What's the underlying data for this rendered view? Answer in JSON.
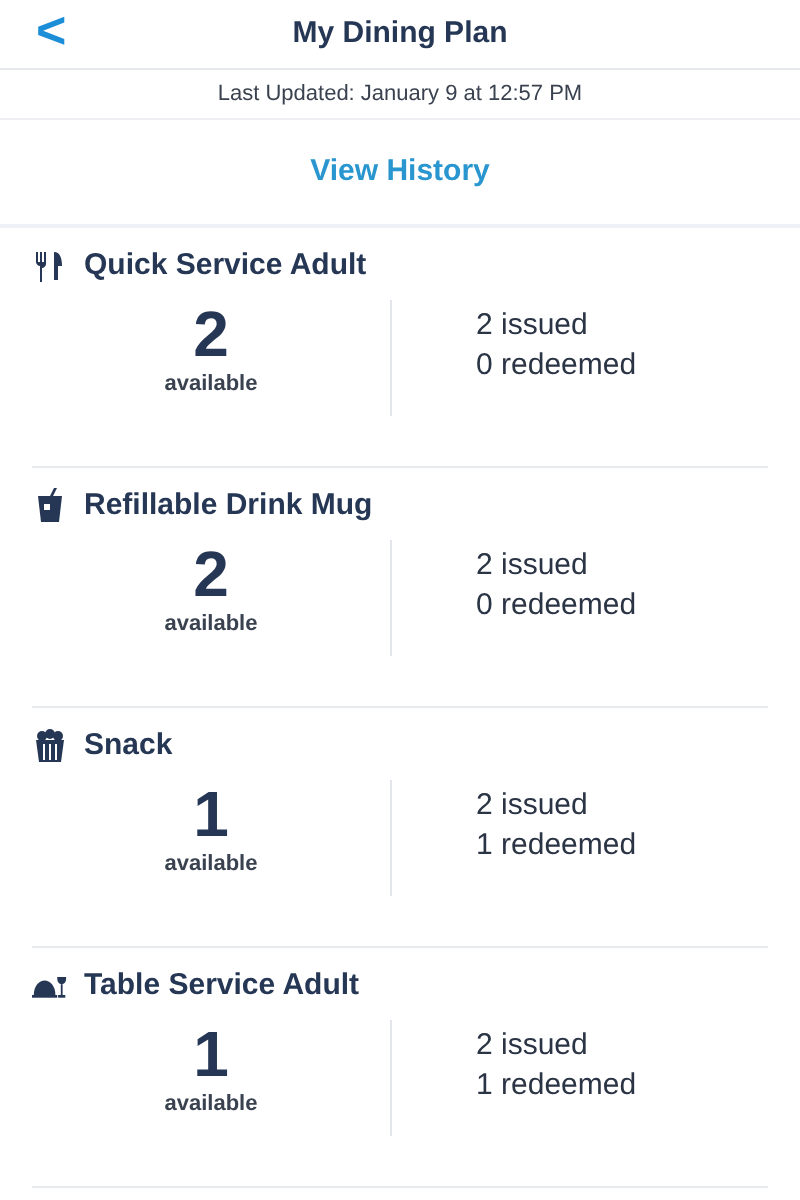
{
  "header": {
    "back": "<",
    "title": "My Dining Plan"
  },
  "last_updated": "Last Updated: January 9 at 12:57 PM",
  "history_link": "View History",
  "plans": [
    {
      "kind": "utensils",
      "name": "Quick Service Adult",
      "available": "2",
      "available_label": "available",
      "issued": "2 issued",
      "redeemed": "0 redeemed"
    },
    {
      "kind": "drink",
      "name": "Refillable Drink Mug",
      "available": "2",
      "available_label": "available",
      "issued": "2 issued",
      "redeemed": "0 redeemed"
    },
    {
      "kind": "popcorn",
      "name": "Snack",
      "available": "1",
      "available_label": "available",
      "issued": "2 issued",
      "redeemed": "1 redeemed"
    },
    {
      "kind": "table",
      "name": "Table Service Adult",
      "available": "1",
      "available_label": "available",
      "issued": "2 issued",
      "redeemed": "1 redeemed"
    }
  ]
}
